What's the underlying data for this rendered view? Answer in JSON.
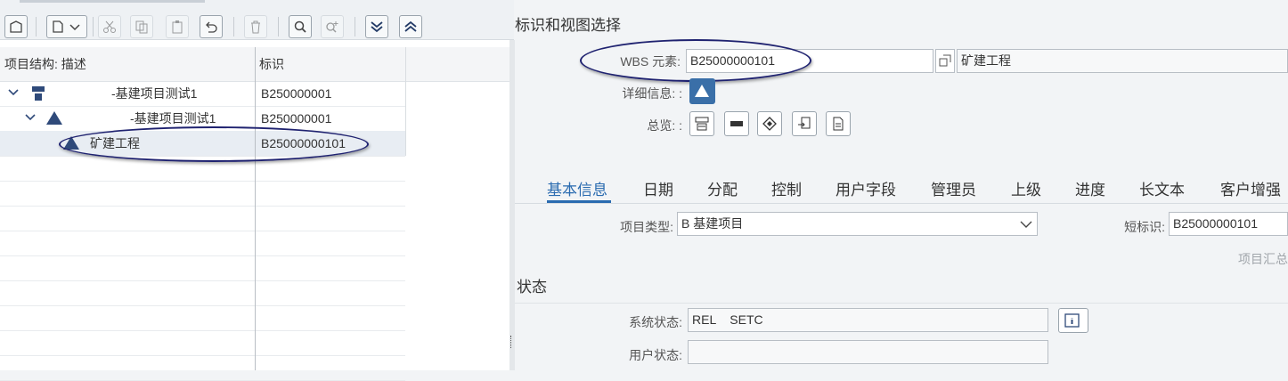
{
  "toolbar": {
    "buttons": [
      "window-icon",
      "new-doc-dropdown",
      "cut-icon",
      "copy-icon",
      "paste-icon",
      "undo-icon",
      "delete-icon",
      "search-icon",
      "search-next-icon",
      "expand-all-icon",
      "collapse-all-icon"
    ]
  },
  "tree": {
    "col_desc": "项目结构: 描述",
    "col_id": "标识",
    "rows": [
      {
        "desc": "-基建项目测试1",
        "id": "B250000001",
        "icon": "project-icon"
      },
      {
        "desc": "-基建项目测试1",
        "id": "B250000001",
        "icon": "wbs-triangle-icon"
      },
      {
        "desc": "矿建工程",
        "id": "B25000000101",
        "icon": "wbs-triangle-icon"
      }
    ]
  },
  "header": {
    "section_title": "标识和视图选择",
    "wbs_label": "WBS 元素:",
    "wbs_value": "B25000000101",
    "wbs_desc": "矿建工程",
    "detail_label": "详细信息: :",
    "overview_label": "总览: :"
  },
  "tabs": [
    "基本信息",
    "日期",
    "分配",
    "控制",
    "用户字段",
    "管理员",
    "上级",
    "进度",
    "长文本",
    "客户增强"
  ],
  "basic": {
    "project_type_label": "项目类型:",
    "project_type_value": "B 基建项目",
    "short_id_label": "短标识:",
    "short_id_value": "B25000000101",
    "project_summary_label": "项目汇总"
  },
  "status": {
    "title": "状态",
    "system_label": "系统状态:",
    "system_value": "REL    SETC",
    "user_label": "用户状态:",
    "user_value": ""
  },
  "colors": {
    "accent": "#2a6bb0",
    "highlight_ring": "#1f2270",
    "tree_icon": "#2f4a7a"
  }
}
